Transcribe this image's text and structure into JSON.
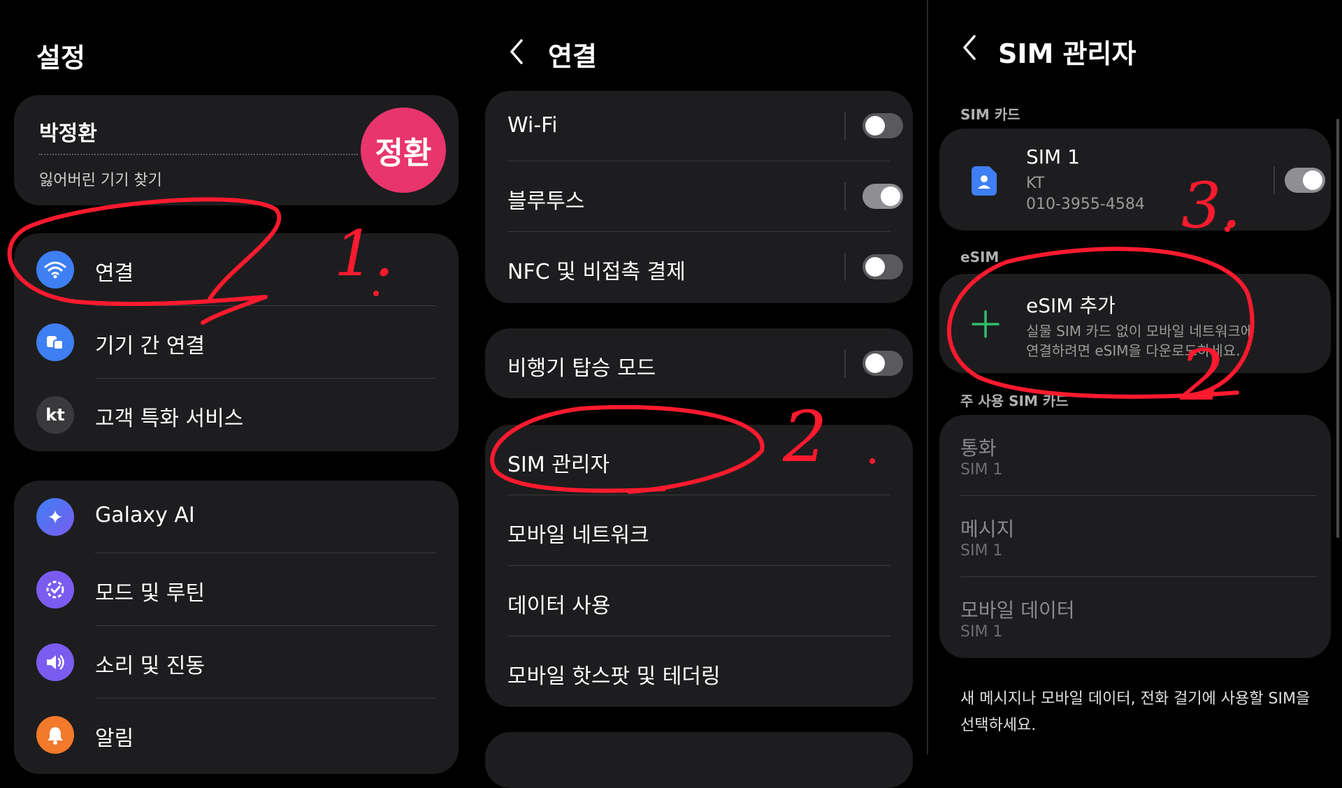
{
  "settings": {
    "title": "설정",
    "profile": {
      "name": "박정환",
      "link": "잃어버린 기기 찾기",
      "avatar_text": "정환"
    },
    "items1": [
      {
        "label": "연결",
        "icon": "wifi-icon"
      },
      {
        "label": "기기 간 연결",
        "icon": "devices-icon"
      },
      {
        "label": "고객 특화 서비스",
        "icon": "kt-icon"
      }
    ],
    "kt_text": "kt",
    "items2": [
      {
        "label": "Galaxy AI",
        "icon": "sparkle-icon"
      },
      {
        "label": "모드 및 루틴",
        "icon": "routine-icon"
      },
      {
        "label": "소리 및 진동",
        "icon": "sound-icon"
      },
      {
        "label": "알림",
        "icon": "bell-icon"
      }
    ]
  },
  "connections": {
    "title": "연결",
    "group1": [
      {
        "label": "Wi-Fi",
        "toggle": false
      },
      {
        "label": "블루투스",
        "toggle": true
      },
      {
        "label": "NFC 및 비접촉 결제",
        "toggle": false
      }
    ],
    "airplane": {
      "label": "비행기 탑승 모드",
      "toggle": false
    },
    "group2": [
      {
        "label": "SIM 관리자"
      },
      {
        "label": "모바일 네트워크"
      },
      {
        "label": "데이터 사용"
      },
      {
        "label": "모바일 핫스팟 및 테더링"
      }
    ]
  },
  "sim": {
    "title": "SIM 관리자",
    "section_sim": "SIM 카드",
    "sim1": {
      "name": "SIM 1",
      "carrier": "KT",
      "number": "010-3955-4584",
      "toggle": true
    },
    "section_esim": "eSIM",
    "esim": {
      "title": "eSIM 추가",
      "desc_line1": "실물 SIM 카드 없이 모바일 네트워크에",
      "desc_line2": "연결하려면 eSIM을 다운로드하세요."
    },
    "section_primary": "주 사용 SIM 카드",
    "primary": [
      {
        "label": "통화",
        "value": "SIM 1"
      },
      {
        "label": "메시지",
        "value": "SIM 1"
      },
      {
        "label": "모바일 데이터",
        "value": "SIM 1"
      }
    ],
    "footer_line1": "새 메시지나 모바일 데이터, 전화 걸기에 사용할 SIM을",
    "footer_line2": "선택하세요."
  },
  "annotations": {
    "one": "1.",
    "two": "2",
    "three": "3.",
    "two_b": "2",
    "color": "#ff1a2e"
  },
  "colors": {
    "card": "#1d1d1f",
    "avatar": "#e8356e",
    "wifi": "#3e7ff3",
    "devices": "#3e7ff3",
    "kt": "#3a3a3c",
    "galaxy_ai": "#4a7cf0",
    "routine": "#7a5cf0",
    "sound": "#7a5cf0",
    "bell": "#f27a2a",
    "plus": "#2fbf6a",
    "sim_icon": "#3e7ff3"
  }
}
